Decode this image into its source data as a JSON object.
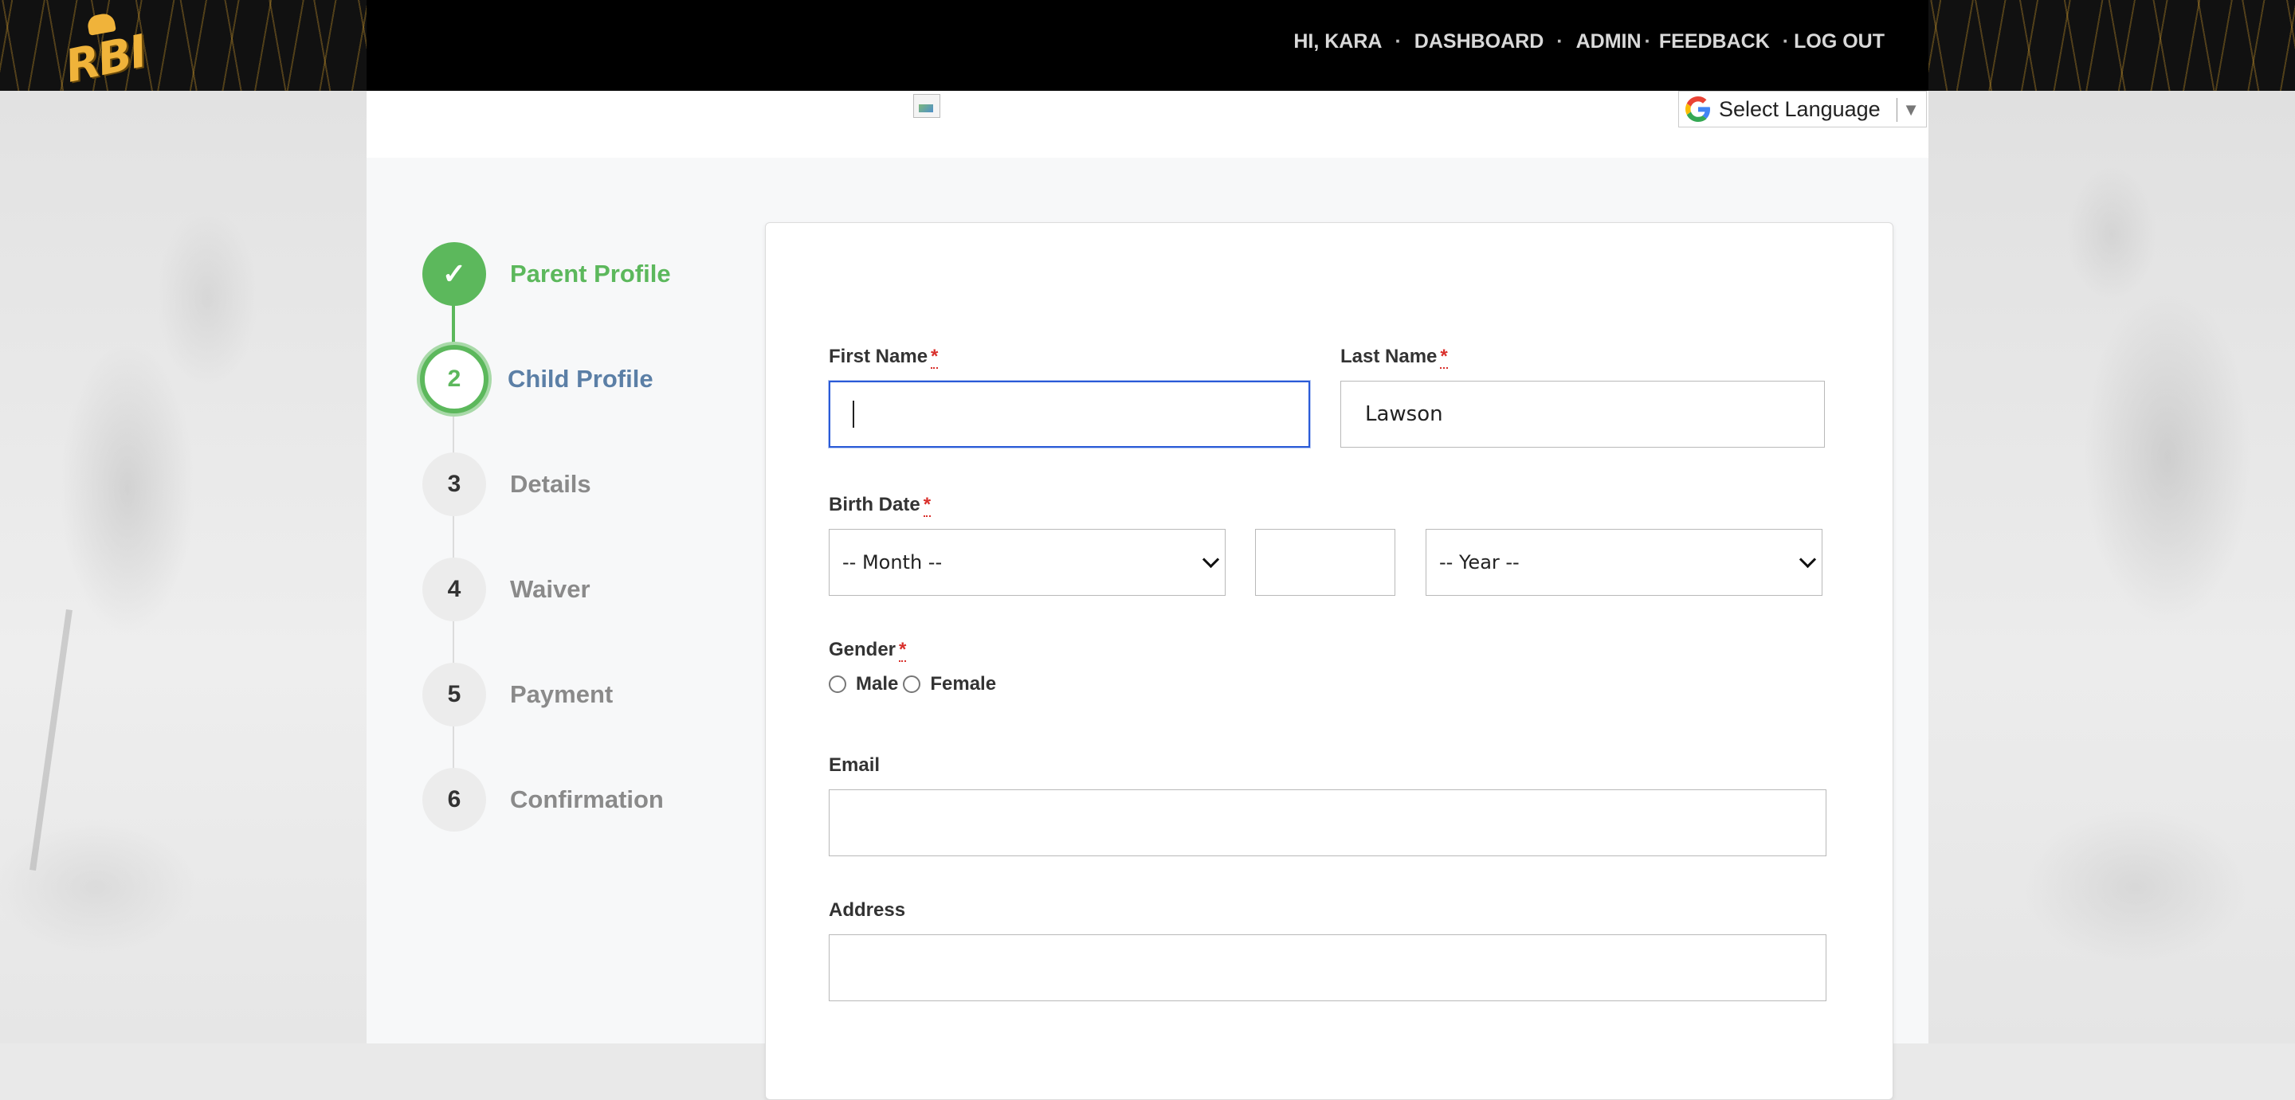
{
  "nav": {
    "greeting": "HI, KARA",
    "items": [
      "DASHBOARD",
      "ADMIN",
      "FEEDBACK",
      "LOG OUT"
    ],
    "separator": "·"
  },
  "logo": {
    "text": "RBI"
  },
  "language": {
    "label": "Select Language",
    "arrow": "▼"
  },
  "steps": [
    {
      "number": "✓",
      "label": "Parent Profile",
      "state": "done"
    },
    {
      "number": "2",
      "label": "Child Profile",
      "state": "current"
    },
    {
      "number": "3",
      "label": "Details",
      "state": "pending"
    },
    {
      "number": "4",
      "label": "Waiver",
      "state": "pending"
    },
    {
      "number": "5",
      "label": "Payment",
      "state": "pending"
    },
    {
      "number": "6",
      "label": "Confirmation",
      "state": "pending"
    }
  ],
  "form": {
    "first_name_label": "First Name",
    "first_name_value": "",
    "last_name_label": "Last Name",
    "last_name_value": "Lawson",
    "birth_date_label": "Birth Date",
    "month_select": "-- Month --",
    "day_value": "",
    "year_select": "-- Year --",
    "gender_label": "Gender",
    "gender_options": [
      "Male",
      "Female"
    ],
    "email_label": "Email",
    "email_value": "",
    "address_label": "Address",
    "address_value": "",
    "required_mark": "*"
  },
  "colors": {
    "accent_green": "#5cb85c",
    "current_blue": "#5b7fa6",
    "focus_blue": "#2a5bd7",
    "required_red": "#d9302c",
    "logo_gold": "#f0b33a"
  }
}
